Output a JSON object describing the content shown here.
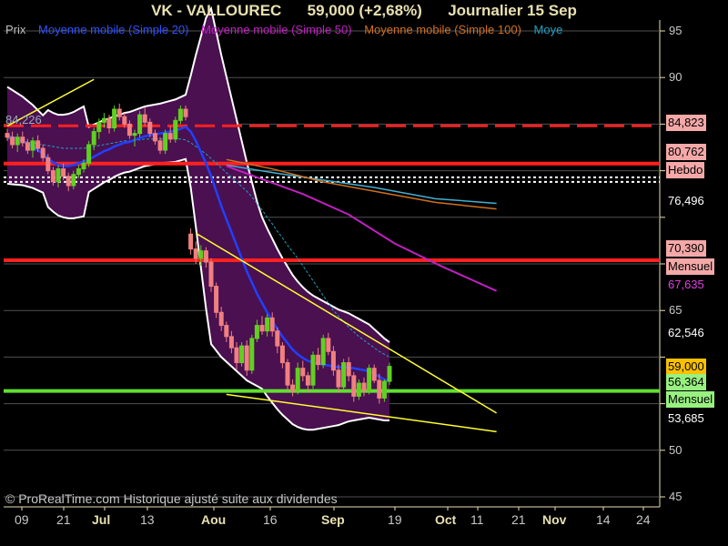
{
  "header": {
    "title": "VK - VALLOUREC",
    "price_change": "59,000 (+2,68%)",
    "period": "Journalier  15 Sep",
    "color": "#e8e0b0"
  },
  "legend": {
    "prix": "Prix",
    "ma20": "Moyenne mobile (Simple 20)",
    "ma50": "Moyenne mobile (Simple 50)",
    "ma100": "Moyenne mobile (Simple 100)",
    "ma_trunc": "Moye",
    "colors": {
      "prix": "#c0c0c0",
      "ma20": "#3050ff",
      "ma50": "#c020c0",
      "ma100": "#d07020",
      "ma_trunc": "#20a0c0"
    }
  },
  "level_label": "84,226",
  "copyright": "© ProRealTime.com Historique ajusté suite aux dividendes",
  "price_axis": {
    "ticks": [
      "95",
      "90",
      "65",
      "50",
      "45"
    ]
  },
  "time_axis": {
    "labels": [
      {
        "text": "09",
        "major": false
      },
      {
        "text": "21",
        "major": false
      },
      {
        "text": "Jul",
        "major": true
      },
      {
        "text": "13",
        "major": false
      },
      {
        "text": "Aou",
        "major": true
      },
      {
        "text": "16",
        "major": false
      },
      {
        "text": "Sep",
        "major": true
      },
      {
        "text": "19",
        "major": false
      },
      {
        "text": "Oct",
        "major": true
      },
      {
        "text": "11",
        "major": false
      },
      {
        "text": "21",
        "major": false
      },
      {
        "text": "Nov",
        "major": true
      },
      {
        "text": "14",
        "major": false
      },
      {
        "text": "24",
        "major": false
      }
    ]
  },
  "tags": [
    {
      "text": "84,823",
      "bg": "#f4a8a8",
      "fg": "#000"
    },
    {
      "text": "80,762",
      "bg": "#f4a8a8",
      "fg": "#000"
    },
    {
      "text": "Hebdo",
      "bg": "#f4a8a8",
      "fg": "#000"
    },
    {
      "text": "76,496",
      "bg": "#000",
      "fg": "#fff"
    },
    {
      "text": "70,390",
      "bg": "#f4a8a8",
      "fg": "#000"
    },
    {
      "text": "Mensuel",
      "bg": "#f4a8a8",
      "fg": "#000"
    },
    {
      "text": "67,635",
      "bg": "#000",
      "fg": "#e040e0"
    },
    {
      "text": "62,546",
      "bg": "#000",
      "fg": "#fff"
    },
    {
      "text": "59,000",
      "bg": "#f8c000",
      "fg": "#000"
    },
    {
      "text": "56,364",
      "bg": "#98f080",
      "fg": "#000"
    },
    {
      "text": "Mensuel",
      "bg": "#98f080",
      "fg": "#000"
    },
    {
      "text": "53,685",
      "bg": "#000",
      "fg": "#fff"
    }
  ],
  "chart_data": {
    "type": "candlestick",
    "ylim": [
      44,
      96
    ],
    "grid": true,
    "levels": [
      {
        "name": "84,823",
        "value": 84.823,
        "color": "#ff2020",
        "style": "dashed"
      },
      {
        "name": "Hebdo",
        "value": 80.762,
        "color": "#ff2020",
        "style": "solid"
      },
      {
        "name": "dotted",
        "value": 78.8,
        "color": "#ffffff",
        "style": "dotted"
      },
      {
        "name": "Mensuel",
        "value": 70.39,
        "color": "#ff2020",
        "style": "solid"
      },
      {
        "name": "Mensuel",
        "value": 56.364,
        "color": "#60e030",
        "style": "solid"
      }
    ],
    "candles": [
      [
        84,
        84.5,
        83.2,
        83.6
      ],
      [
        83.6,
        84.2,
        82.4,
        82.8
      ],
      [
        82.8,
        84.0,
        82.0,
        83.6
      ],
      [
        83.6,
        84.2,
        82.6,
        83.0
      ],
      [
        83.0,
        83.4,
        81.8,
        82.2
      ],
      [
        82.2,
        83.6,
        81.4,
        83.2
      ],
      [
        83.2,
        83.8,
        82.0,
        82.4
      ],
      [
        82.4,
        82.8,
        81.0,
        81.4
      ],
      [
        81.4,
        81.8,
        79.6,
        80.0
      ],
      [
        80.0,
        80.4,
        78.4,
        78.8
      ],
      [
        78.8,
        80.6,
        78.2,
        80.2
      ],
      [
        80.2,
        80.8,
        79.0,
        79.4
      ],
      [
        79.4,
        79.8,
        77.8,
        78.4
      ],
      [
        78.4,
        80.0,
        78.0,
        79.6
      ],
      [
        79.6,
        80.6,
        79.2,
        80.2
      ],
      [
        80.2,
        81.2,
        79.8,
        80.8
      ],
      [
        80.8,
        83.2,
        80.4,
        82.8
      ],
      [
        82.8,
        84.6,
        82.2,
        84.2
      ],
      [
        84.2,
        85.6,
        83.4,
        85.2
      ],
      [
        85.2,
        86.2,
        84.6,
        85.6
      ],
      [
        85.6,
        86.0,
        84.0,
        84.6
      ],
      [
        84.6,
        87.0,
        84.2,
        86.6
      ],
      [
        86.6,
        87.2,
        85.4,
        85.8
      ],
      [
        85.8,
        86.2,
        84.6,
        85.0
      ],
      [
        85.0,
        85.4,
        83.4,
        83.8
      ],
      [
        83.8,
        84.4,
        82.6,
        84.0
      ],
      [
        84.0,
        86.4,
        83.6,
        86.0
      ],
      [
        86.0,
        86.8,
        84.8,
        85.2
      ],
      [
        85.2,
        85.6,
        83.6,
        84.0
      ],
      [
        84.0,
        84.4,
        82.8,
        83.2
      ],
      [
        83.2,
        83.6,
        81.8,
        82.2
      ],
      [
        82.2,
        84.4,
        81.8,
        84.0
      ],
      [
        84.0,
        84.8,
        83.0,
        83.4
      ],
      [
        83.4,
        85.8,
        83.0,
        85.4
      ],
      [
        85.4,
        87.0,
        85.0,
        86.6
      ],
      [
        86.6,
        87.0,
        85.4,
        85.8
      ],
      [
        73.2,
        73.8,
        71.0,
        71.6
      ],
      [
        71.6,
        72.4,
        70.0,
        70.6
      ],
      [
        70.6,
        72.0,
        69.8,
        71.4
      ],
      [
        71.4,
        71.8,
        69.6,
        70.2
      ],
      [
        70.2,
        70.6,
        67.0,
        67.6
      ],
      [
        67.6,
        68.0,
        64.2,
        64.8
      ],
      [
        64.8,
        65.4,
        62.8,
        63.4
      ],
      [
        63.4,
        63.8,
        61.6,
        62.2
      ],
      [
        62.2,
        62.8,
        60.4,
        61.0
      ],
      [
        61.0,
        61.6,
        58.6,
        59.4
      ],
      [
        59.4,
        61.6,
        59.0,
        61.2
      ],
      [
        61.2,
        61.8,
        58.0,
        58.6
      ],
      [
        58.6,
        62.4,
        58.2,
        62.0
      ],
      [
        62.0,
        64.0,
        61.6,
        63.4
      ],
      [
        63.4,
        64.4,
        62.4,
        62.8
      ],
      [
        62.8,
        64.6,
        62.2,
        64.2
      ],
      [
        64.2,
        64.8,
        62.2,
        62.8
      ],
      [
        62.8,
        63.2,
        60.4,
        61.2
      ],
      [
        61.2,
        61.6,
        58.8,
        59.4
      ],
      [
        59.4,
        59.8,
        56.4,
        57.0
      ],
      [
        57.0,
        57.6,
        55.8,
        56.4
      ],
      [
        56.4,
        59.4,
        56.0,
        58.8
      ],
      [
        58.8,
        59.6,
        57.4,
        58.0
      ],
      [
        58.0,
        58.4,
        56.2,
        57.0
      ],
      [
        57.0,
        60.6,
        56.6,
        60.2
      ],
      [
        60.2,
        61.0,
        58.6,
        59.2
      ],
      [
        59.2,
        62.4,
        58.8,
        62.0
      ],
      [
        62.0,
        62.6,
        60.2,
        60.6
      ],
      [
        60.6,
        61.2,
        58.0,
        58.6
      ],
      [
        58.6,
        59.2,
        56.2,
        56.8
      ],
      [
        56.8,
        59.8,
        56.4,
        59.4
      ],
      [
        59.4,
        60.0,
        57.4,
        58.0
      ],
      [
        58.0,
        58.4,
        55.2,
        55.8
      ],
      [
        55.8,
        57.6,
        55.4,
        57.2
      ],
      [
        57.2,
        57.8,
        55.8,
        56.4
      ],
      [
        56.4,
        59.2,
        56.0,
        58.8
      ],
      [
        58.8,
        59.2,
        57.2,
        57.5
      ],
      [
        57.5,
        58.2,
        55.0,
        55.6
      ],
      [
        55.6,
        57.6,
        55.2,
        57.4
      ],
      [
        57.4,
        59.4,
        57.0,
        59.0
      ]
    ],
    "ma20": [
      83.8,
      83.6,
      83.4,
      83.2,
      82.9,
      82.6,
      82.2,
      81.8,
      81.3,
      80.9,
      80.6,
      80.5,
      80.5,
      80.6,
      80.8,
      81.0,
      81.2,
      81.5,
      81.8,
      82.1,
      82.3,
      82.6,
      82.8,
      83.0,
      83.1,
      83.3,
      83.5,
      83.7,
      83.8,
      83.9,
      84.0,
      84.1,
      84.2,
      84.3,
      84.5,
      84.7,
      84.2,
      83.2,
      82.0,
      80.8,
      79.4,
      77.8,
      76.2,
      74.8,
      73.4,
      72.0,
      70.6,
      69.2,
      68.0,
      66.8,
      65.8,
      64.8,
      63.9,
      63.0,
      62.2,
      61.5,
      60.8,
      60.3,
      59.9,
      59.6,
      59.4,
      59.3,
      59.2,
      59.1,
      59.0,
      58.9,
      58.9,
      58.9,
      58.8,
      58.7,
      58.6,
      58.5,
      58.2,
      57.9,
      57.6,
      57.4
    ],
    "ma50": [
      83.5,
      83.4,
      83.3,
      83.2,
      83.1,
      83.0,
      82.9,
      82.8,
      82.7,
      82.6,
      82.5,
      82.4,
      82.4,
      82.4,
      82.4,
      82.4,
      82.5,
      82.6,
      82.7,
      82.8,
      82.9,
      83.0,
      83.1,
      83.2,
      83.2,
      83.3,
      83.3,
      83.4,
      83.4,
      83.4,
      83.4,
      83.4,
      83.4,
      83.4,
      83.4,
      83.3,
      83.0,
      82.6,
      82.2,
      81.8,
      81.3,
      80.8,
      80.3,
      79.8,
      79.3,
      78.8,
      78.3,
      77.8,
      77.2,
      76.5,
      75.8,
      75.0,
      74.3,
      73.5,
      72.8,
      72.0,
      71.3,
      70.6,
      69.8,
      69.0,
      68.2,
      67.4,
      66.6,
      65.8,
      65.0,
      64.4,
      63.8,
      63.2,
      62.7,
      62.2,
      61.8,
      61.4,
      61.0,
      60.6,
      60.3,
      60.0
    ],
    "ma50_seg": [
      [
        43,
        80.5
      ],
      [
        58,
        77.5
      ],
      [
        67,
        75.3
      ],
      [
        76,
        72.2
      ],
      [
        85,
        69.8
      ],
      [
        96,
        67.1
      ]
    ],
    "ma100_seg": [
      [
        43,
        81.2
      ],
      [
        52,
        80.2
      ],
      [
        62,
        78.8
      ],
      [
        72,
        77.8
      ],
      [
        84,
        76.6
      ],
      [
        96,
        75.9
      ]
    ],
    "ma_cyan_seg": [
      [
        43,
        80.6
      ],
      [
        52,
        79.8
      ],
      [
        62,
        79.0
      ],
      [
        72,
        78.2
      ],
      [
        84,
        77.0
      ],
      [
        96,
        76.5
      ]
    ],
    "trendlines": [
      {
        "p1": [
          0,
          84.8
        ],
        "p2": [
          17,
          89.8
        ]
      },
      {
        "p1": [
          37,
          73.3
        ],
        "p2": [
          96,
          54.0
        ]
      },
      {
        "p1": [
          43,
          56.0
        ],
        "p2": [
          96,
          52.0
        ]
      }
    ]
  }
}
